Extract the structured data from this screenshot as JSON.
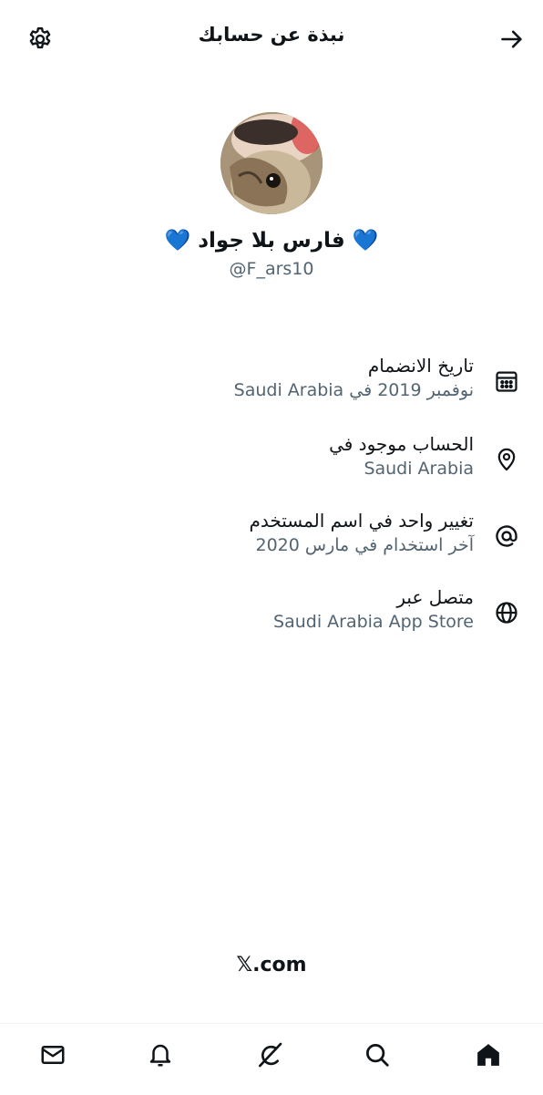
{
  "header": {
    "title": "نبذة عن حسابك",
    "back_icon": "arrow-right-icon",
    "settings_icon": "gear-icon"
  },
  "profile": {
    "display_name": "فارس بلا جواد",
    "heart_emoji": "💙",
    "handle": "@F_ars10"
  },
  "info_items": [
    {
      "label": "تاريخ الانضمام",
      "value": "نوفمبر 2019 في Saudi Arabia",
      "icon": "calendar-icon"
    },
    {
      "label": "الحساب موجود في",
      "value": "Saudi Arabia",
      "icon": "location-pin-icon"
    },
    {
      "label": "تغيير واحد في اسم المستخدم",
      "value": "آخر استخدام في مارس 2020",
      "icon": "at-sign-icon"
    },
    {
      "label": "متصل عبر",
      "value": "Saudi Arabia App Store",
      "icon": "globe-icon"
    }
  ],
  "footer": {
    "brand": "𝕏.com"
  },
  "bottom_nav": {
    "items": [
      "messages-icon",
      "notifications-icon",
      "grok-icon",
      "search-icon",
      "home-icon"
    ]
  },
  "colors": {
    "text_primary": "#0f1419",
    "text_secondary": "#536471",
    "heart": "#1d6fe0"
  }
}
